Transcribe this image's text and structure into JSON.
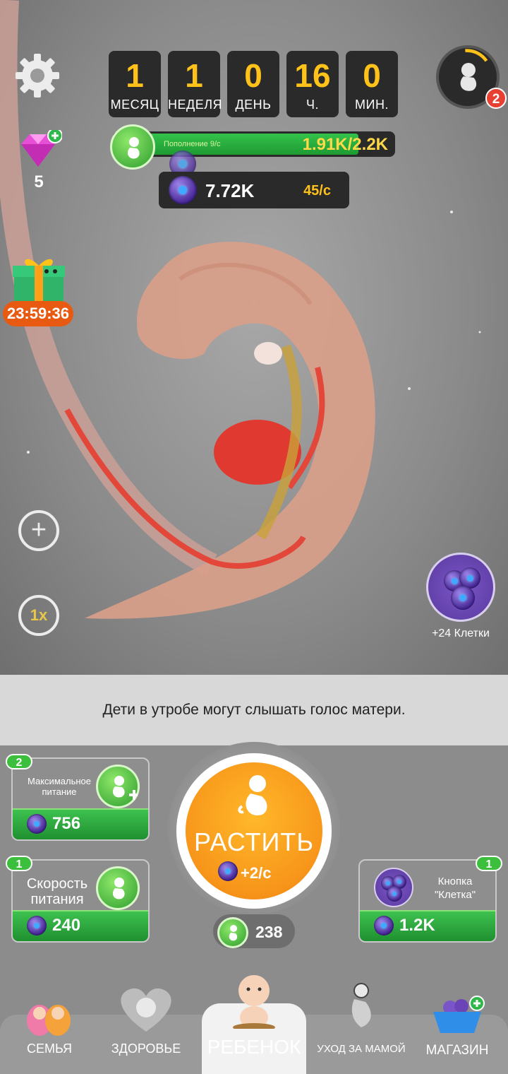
{
  "time": [
    {
      "value": "1",
      "unit": "МЕСЯЦ"
    },
    {
      "value": "1",
      "unit": "НЕДЕЛЯ"
    },
    {
      "value": "0",
      "unit": "ДЕНЬ"
    },
    {
      "value": "16",
      "unit": "Ч."
    },
    {
      "value": "0",
      "unit": "МИН."
    }
  ],
  "nutrition": {
    "rate_label": "Пополнение 9/с",
    "value": "1.91K/2.2K",
    "fill_fraction": 0.87
  },
  "cells": {
    "value": "7.72K",
    "rate": "45/с"
  },
  "gems": {
    "count": "5"
  },
  "gift": {
    "timer": "23:59:36"
  },
  "avatar": {
    "badge": "2"
  },
  "side_buttons": {
    "speed_label": "1x"
  },
  "cells_bonus": {
    "label": "+24 Клетки"
  },
  "tip": "Дети в утробе могут слышать голос матери.",
  "upgrades": {
    "max_nutrition": {
      "level": "2",
      "label_line1": "Максимальное",
      "label_line2": "питание",
      "price": "756"
    },
    "nutrition_speed": {
      "level": "1",
      "label_line1": "Скорость",
      "label_line2": "питания",
      "price": "240"
    },
    "cell_button": {
      "level": "1",
      "label_line1": "Кнопка",
      "label_line2": "\"Клетка\"",
      "price": "1.2K"
    }
  },
  "grow": {
    "label": "РАСТИТЬ",
    "rate": "+2/с",
    "count": "238"
  },
  "nav": {
    "family": "СЕМЬЯ",
    "health": "ЗДОРОВЬЕ",
    "child": "РЕБЕНОК",
    "mom_care": "УХОД ЗА МАМОЙ",
    "shop": "МАГАЗИН"
  },
  "colors": {
    "accent_orange": "#f7951a",
    "green": "#2e9e2e",
    "gold_text": "#ffc21a"
  }
}
